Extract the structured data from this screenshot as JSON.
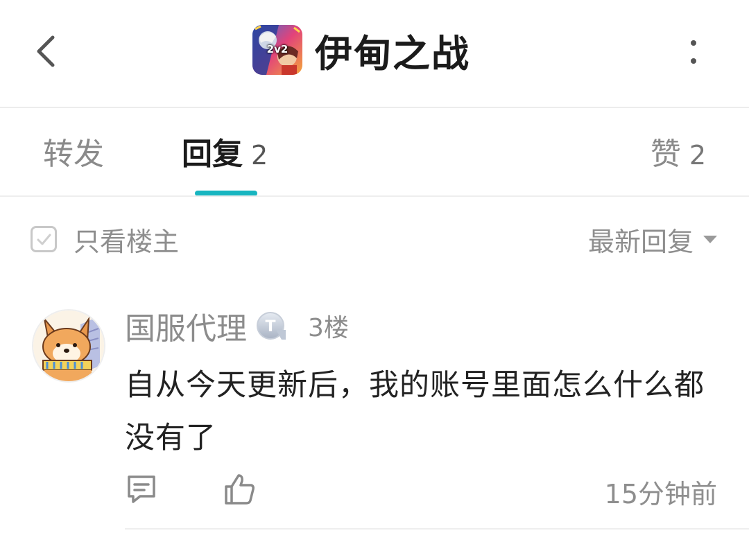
{
  "header": {
    "title": "伊甸之战",
    "app_icon_text": "2v2",
    "back_icon": "chevron-left-icon",
    "more_icon": "more-vertical-icon"
  },
  "tabs": [
    {
      "label": "转发",
      "count": ""
    },
    {
      "label": "回复",
      "count": "2"
    },
    {
      "label": "赞",
      "count": "2"
    }
  ],
  "active_tab": "回复",
  "filter": {
    "only_op_label": "只看楼主",
    "only_op_checked": false,
    "sort_label": "最新回复"
  },
  "comment": {
    "username": "国服代理",
    "badge_letter": "T",
    "floor": "3楼",
    "content": "自从今天更新后，我的账号里面怎么什么都没有了",
    "time": "15分钟前"
  },
  "colors": {
    "accent": "#17b5c0",
    "text_primary": "#222222",
    "text_secondary": "#8c8c8c",
    "divider": "#eeeeee"
  }
}
